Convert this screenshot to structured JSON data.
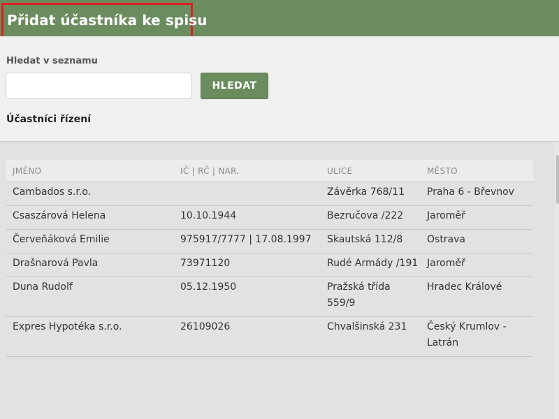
{
  "header": {
    "title": "Přidat účastníka ke spisu"
  },
  "search": {
    "label": "Hledat v seznamu",
    "value": "",
    "placeholder": "",
    "button_label": "HLEDAT"
  },
  "section": {
    "title": "Účastníci řízení"
  },
  "table": {
    "columns": [
      "JMÉNO",
      "IČ | RČ | NAR.",
      "ULICE",
      "MĚSTO"
    ],
    "rows": [
      {
        "name": "Cambados s.r.o.",
        "id": "",
        "street": "Závěrka 768/11",
        "city": "Praha 6 - Břevnov"
      },
      {
        "name": "Csaszárová Helena",
        "id": "10.10.1944",
        "street": "Bezručova /222",
        "city": "Jaroměř"
      },
      {
        "name": "Červeňáková Emilie",
        "id": "975917/7777 | 17.08.1997",
        "street": "Skautská 112/8",
        "city": "Ostrava"
      },
      {
        "name": "Drašnarová Pavla",
        "id": "73971120",
        "street": "Rudé Armády /191",
        "city": "Jaroměř"
      },
      {
        "name": "Duna Rudolf",
        "id": "05.12.1950",
        "street": "Pražská třída 559/9",
        "city": "Hradec Králové"
      },
      {
        "name": "Expres Hypotéka s.r.o.",
        "id": "26109026",
        "street": "Chvalšinská 231",
        "city": "Český Krumlov - Latrán"
      }
    ]
  }
}
